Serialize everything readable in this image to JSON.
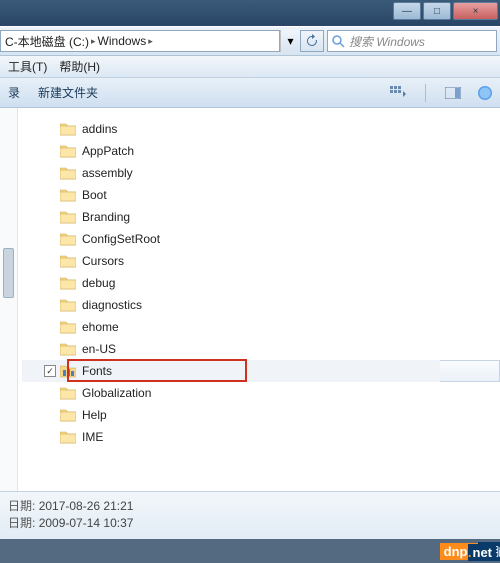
{
  "window": {
    "minimize": "—",
    "maximize": "□",
    "close": "×"
  },
  "addressbar": {
    "crumb1": "C-本地磁盘 (C:)",
    "crumb2": "Windows",
    "arrow": "▸",
    "dropdown": "▾",
    "refresh": "↻"
  },
  "search": {
    "placeholder": "搜索 Windows"
  },
  "menu": {
    "tools": "工具(T)",
    "help": "帮助(H)"
  },
  "toolbar": {
    "organize_suffix": "录",
    "new_folder": "新建文件夹"
  },
  "folders": [
    {
      "name": "addins",
      "selected": false
    },
    {
      "name": "AppPatch",
      "selected": false
    },
    {
      "name": "assembly",
      "selected": false
    },
    {
      "name": "Boot",
      "selected": false
    },
    {
      "name": "Branding",
      "selected": false
    },
    {
      "name": "ConfigSetRoot",
      "selected": false
    },
    {
      "name": "Cursors",
      "selected": false
    },
    {
      "name": "debug",
      "selected": false
    },
    {
      "name": "diagnostics",
      "selected": false
    },
    {
      "name": "ehome",
      "selected": false
    },
    {
      "name": "en-US",
      "selected": false
    },
    {
      "name": "Fonts",
      "selected": true,
      "highlight": true,
      "special": true
    },
    {
      "name": "Globalization",
      "selected": false
    },
    {
      "name": "Help",
      "selected": false
    },
    {
      "name": "IME",
      "selected": false
    }
  ],
  "details": {
    "label1": "日期:",
    "value1": "2017-08-26 21:21",
    "label2": "日期:",
    "value2": "2009-07-14 10:37"
  },
  "watermark": {
    "brand": "dnpz",
    "cn": "电脑配置网",
    "dot": ".",
    "tld": "net"
  }
}
